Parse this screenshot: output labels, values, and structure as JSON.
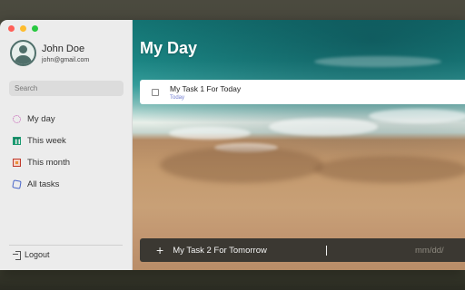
{
  "window": {
    "title": "My Day"
  },
  "profile": {
    "name": "John Doe",
    "email": "john@gmail.com",
    "avatar_icon": "user-avatar-icon"
  },
  "search": {
    "placeholder": "Search"
  },
  "sidebar": {
    "items": [
      {
        "label": "My day",
        "icon": "sun-icon",
        "color": "#c45ab3"
      },
      {
        "label": "This week",
        "icon": "calendar-grid-icon",
        "color": "#1d9b72"
      },
      {
        "label": "This month",
        "icon": "calendar-month-icon",
        "color": "#c0392b"
      },
      {
        "label": "All tasks",
        "icon": "tasks-icon",
        "color": "#4a67c9"
      }
    ],
    "logout_label": "Logout"
  },
  "main": {
    "title": "My Day",
    "tasks": [
      {
        "title": "My Task 1 For Today",
        "due": "Today",
        "completed": false
      }
    ],
    "new_task": {
      "value": "My Task 2 For Tomorrow",
      "date_placeholder": "mm/dd/"
    }
  },
  "colors": {
    "accent_due": "#6f7bd0",
    "input_bar": "#3b3832",
    "sidebar_bg": "#ececec"
  }
}
